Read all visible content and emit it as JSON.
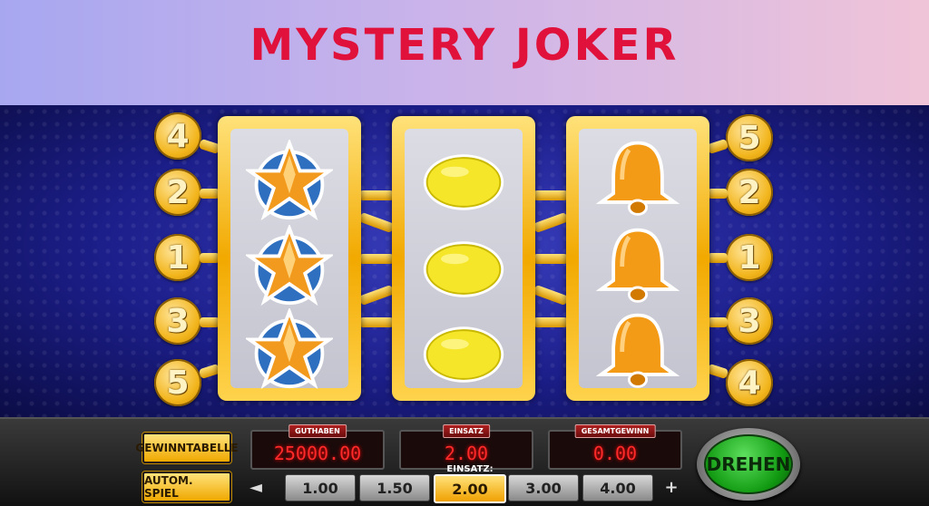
{
  "title": "MYSTERY JOKER",
  "reels": [
    {
      "symbols": [
        "star-icon",
        "star-icon",
        "star-icon"
      ]
    },
    {
      "symbols": [
        "lemon-icon",
        "lemon-icon",
        "lemon-icon"
      ]
    },
    {
      "symbols": [
        "bell-icon",
        "bell-icon",
        "bell-icon"
      ]
    }
  ],
  "paylines": {
    "left": [
      "4",
      "2",
      "1",
      "3",
      "5"
    ],
    "right": [
      "5",
      "2",
      "1",
      "3",
      "4"
    ]
  },
  "buttons": {
    "paytable": "GEWINNTABELLE",
    "autoplay": "AUTOM. SPIEL",
    "spin": "DREHEN",
    "prev": "◄",
    "next": "+"
  },
  "displays": {
    "balance_label": "GUTHABEN",
    "balance": "25000.00",
    "bet_label": "EINSATZ",
    "bet": "2.00",
    "win_label": "GESAMTGEWINN",
    "win": "0.00"
  },
  "stake_label": "EINSATZ:",
  "stakes": [
    "1.00",
    "1.50",
    "2.00",
    "3.00",
    "4.00"
  ],
  "selected_stake": "2.00",
  "colors": {
    "title": "#e0123b",
    "gold": "#f2a900",
    "led": "#ff2a2a",
    "spin": "#119a11"
  }
}
